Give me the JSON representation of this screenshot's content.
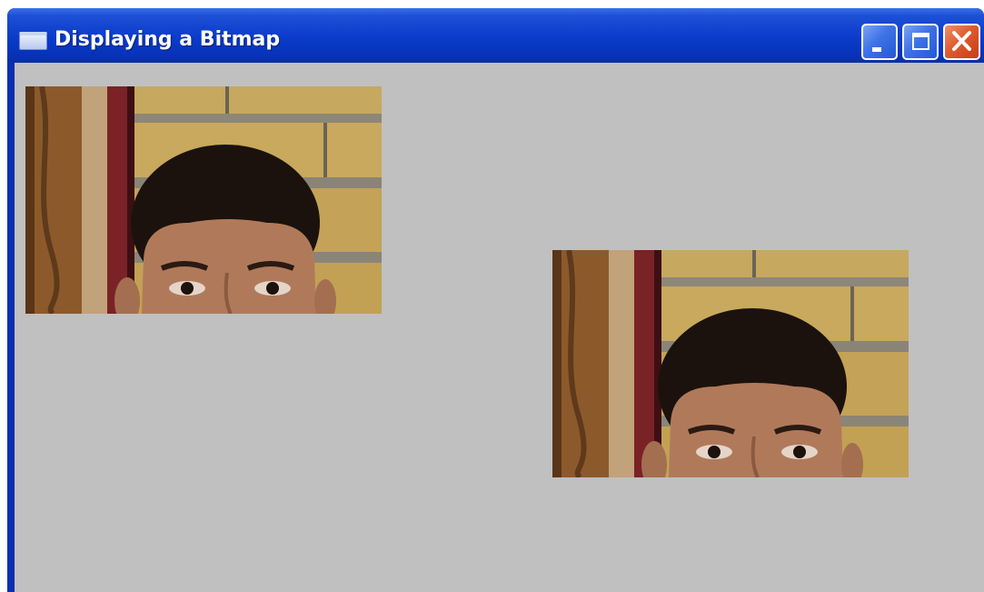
{
  "window": {
    "title": "Displaying a Bitmap",
    "title_icon": "window-app-icon",
    "controls": [
      {
        "name": "minimize",
        "icon": "minimize-icon"
      },
      {
        "name": "maximize",
        "icon": "maximize-icon"
      },
      {
        "name": "close",
        "icon": "close-icon"
      }
    ]
  },
  "client": {
    "background": "#c0c0c0",
    "bitmaps": [
      {
        "name": "bitmap-top-left",
        "content": "photo-boy-brick-wall"
      },
      {
        "name": "bitmap-bottom-right",
        "content": "photo-boy-brick-wall"
      }
    ]
  },
  "colors": {
    "titlebar": "#0a3bcb",
    "close_button": "#e05a2e",
    "client_background": "#c0c0c0"
  }
}
